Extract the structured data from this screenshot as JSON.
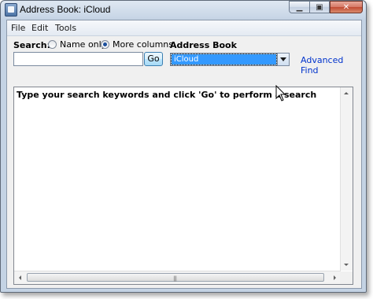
{
  "window": {
    "title": "Address Book: iCloud"
  },
  "menu": {
    "items": [
      "File",
      "Edit",
      "Tools"
    ]
  },
  "search": {
    "label": "Search:",
    "radio_name_only": "Name only",
    "radio_more_columns": "More columns",
    "selected_option": "More columns",
    "input_value": "",
    "go_label": "Go"
  },
  "address_book": {
    "label": "Address Book",
    "selected": "iCloud"
  },
  "advanced_find": {
    "label": "Advanced Find"
  },
  "results": {
    "message": "Type your search keywords and click 'Go' to perform a search"
  },
  "icons": {
    "app": "address-book-icon",
    "minimize": "minimize-icon",
    "maximize": "maximize-icon",
    "close": "close-icon",
    "cursor": "mouse-pointer-icon"
  }
}
